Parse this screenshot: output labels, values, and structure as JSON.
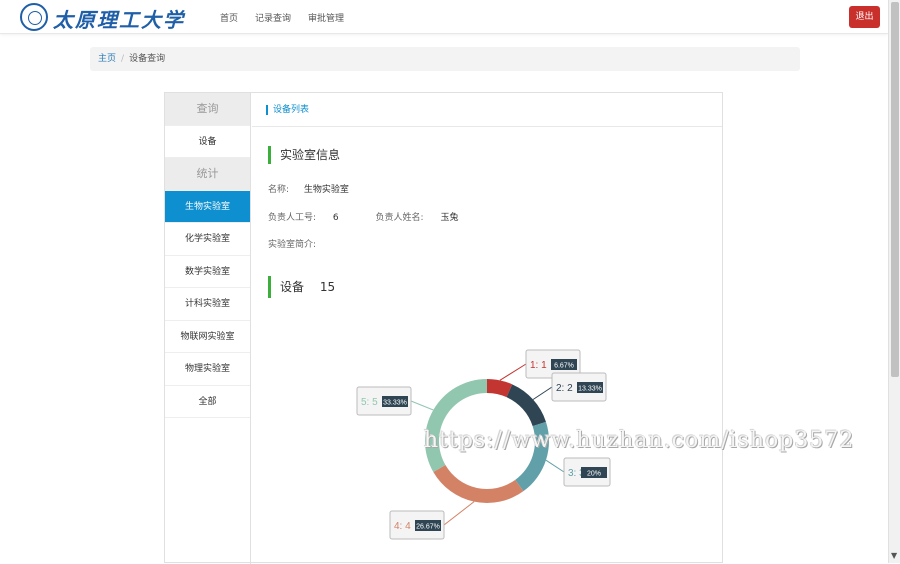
{
  "header": {
    "logo_text": "太原理工大学",
    "nav": [
      "首页",
      "记录查询",
      "审批管理"
    ],
    "logout_label": "退出"
  },
  "breadcrumb": {
    "home": "主页",
    "sep": "/",
    "current": "设备查询"
  },
  "sidebar": {
    "items": [
      {
        "label": "查询",
        "kind": "group"
      },
      {
        "label": "设备",
        "kind": "item"
      },
      {
        "label": "统计",
        "kind": "group"
      },
      {
        "label": "生物实验室",
        "kind": "active"
      },
      {
        "label": "化学实验室",
        "kind": "item"
      },
      {
        "label": "数学实验室",
        "kind": "item"
      },
      {
        "label": "计科实验室",
        "kind": "item"
      },
      {
        "label": "物联网实验室",
        "kind": "item"
      },
      {
        "label": "物理实验室",
        "kind": "item"
      },
      {
        "label": "全部",
        "kind": "item"
      }
    ]
  },
  "main": {
    "tab_title": "设备列表",
    "lab_section_title": "实验室信息",
    "name_label": "名称:",
    "name_value": "生物实验室",
    "manager_id_label": "负责人工号:",
    "manager_id_value": "6",
    "manager_name_label": "负责人姓名:",
    "manager_name_value": "玉兔",
    "intro_label": "实验室简介:",
    "intro_value": "",
    "device_section_title": "设备",
    "device_count": "15"
  },
  "watermark": "https://www.huzhan.com/ishop3572",
  "chart_data": {
    "type": "pie",
    "donut": true,
    "categories": [
      "1",
      "2",
      "3",
      "4",
      "5"
    ],
    "values": [
      1,
      2,
      3,
      4,
      5
    ],
    "percent_labels": [
      "6.67%",
      "13.33%",
      "20%",
      "26.67%",
      "33.33%"
    ],
    "tooltip_labels": [
      "1: 1",
      "2: 2",
      "3: 3",
      "4: 4",
      "5: 5"
    ],
    "colors": [
      "#c23531",
      "#2f4554",
      "#61a0a8",
      "#d48265",
      "#91c7ae"
    ]
  },
  "colors": {
    "accent": "#0e8fcf",
    "danger": "#c9302c",
    "section_bar": "#3cae3c"
  }
}
